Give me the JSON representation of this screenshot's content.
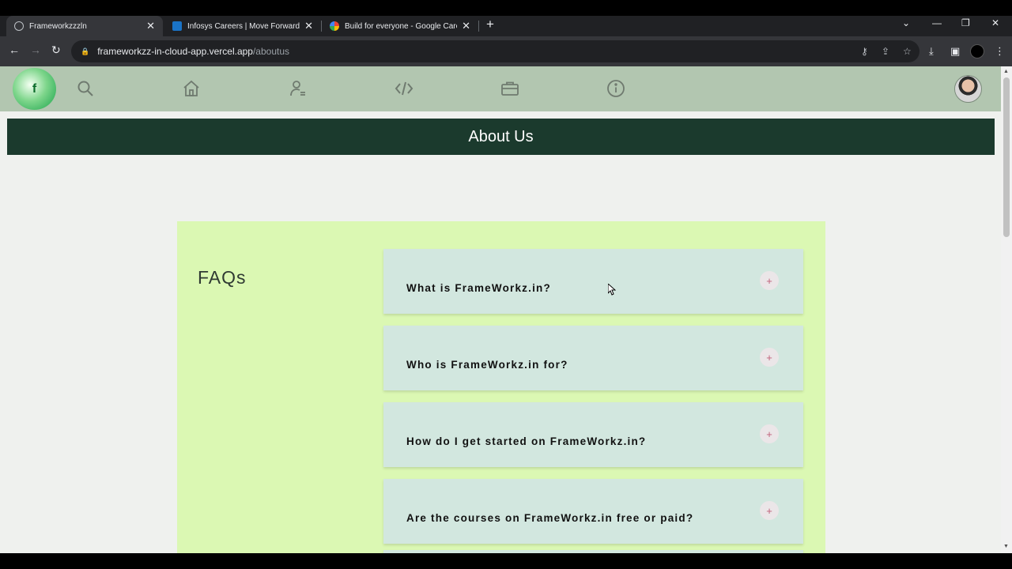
{
  "browser": {
    "tabs": [
      {
        "title": "Frameworkzzzln",
        "active": true,
        "favicon": "globe-icon"
      },
      {
        "title": "Infosys Careers | Move Forward. T",
        "active": false,
        "favicon": "infosys-icon"
      },
      {
        "title": "Build for everyone - Google Care",
        "active": false,
        "favicon": "google-icon"
      }
    ],
    "url_host": "frameworkzz-in-cloud-app.vercel.app",
    "url_path": "/aboutus"
  },
  "site": {
    "logo_text": "f",
    "nav_icons": [
      "search-icon",
      "home-icon",
      "profile-icon",
      "code-icon",
      "briefcase-icon",
      "info-icon"
    ],
    "header_title": "About Us",
    "accent_color": "#1b3a2d"
  },
  "faq": {
    "title": "FAQs",
    "items": [
      {
        "question": "What is FrameWorkz.in?",
        "toggle": "+"
      },
      {
        "question": "Who is FrameWorkz.in for?",
        "toggle": "+"
      },
      {
        "question": "How do I get started on FrameWorkz.in?",
        "toggle": "+"
      },
      {
        "question": "Are the courses on FrameWorkz.in free or paid?",
        "toggle": "+"
      }
    ]
  }
}
